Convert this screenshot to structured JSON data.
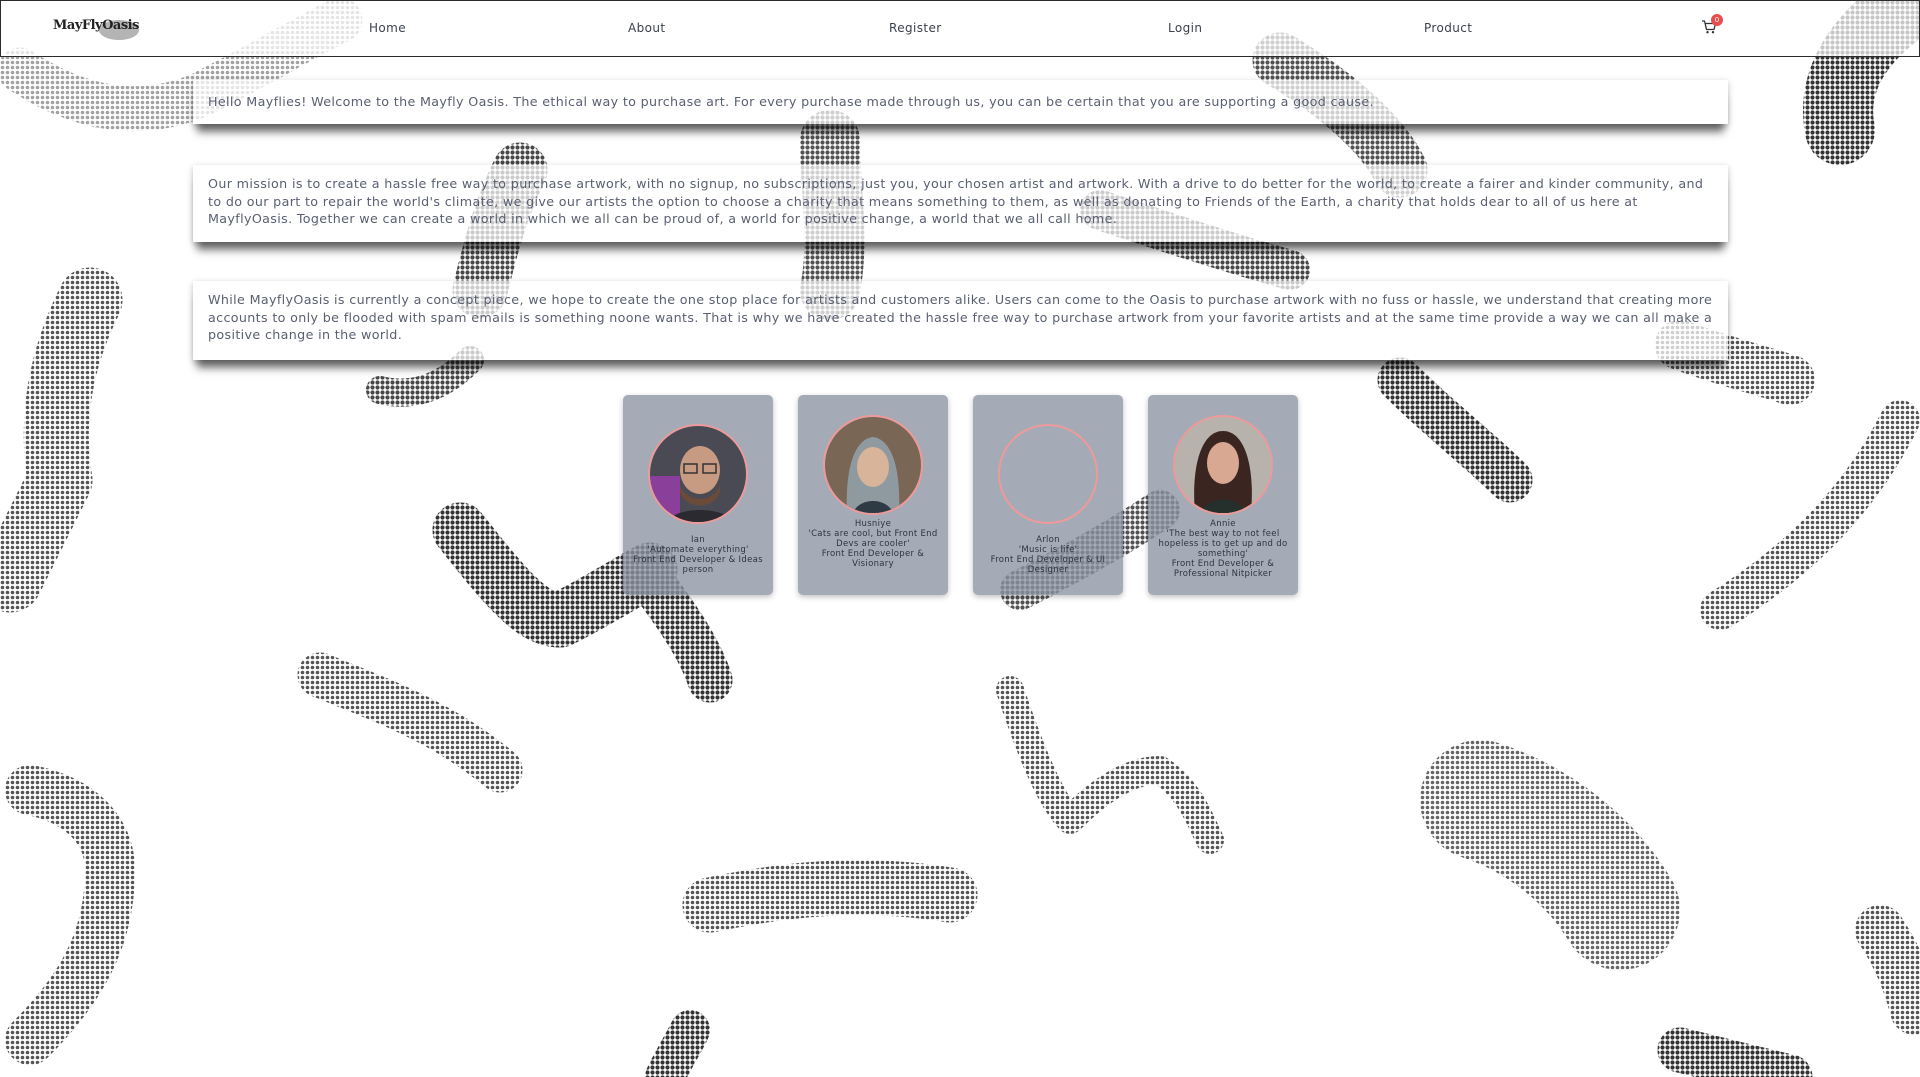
{
  "nav": {
    "logo": "MayFlyOasis",
    "links": [
      "Home",
      "About",
      "Register",
      "Login",
      "Product"
    ],
    "cart_count": "0"
  },
  "intro": {
    "welcome": "Hello Mayflies! Welcome to the Mayfly Oasis. The ethical way to purchase art. For every purchase made through us, you can be certain that you are supporting a good cause.",
    "mission": "Our mission is to create a hassle free way to purchase artwork, with no signup, no subscriptions, just you, your chosen artist and artwork. With a drive to do better for the world, to create a fairer and kinder community, and to do our part to repair the world's climate, we give our artists the option to choose a charity that means something to them, as well as donating to Friends of the Earth, a charity that holds dear to all of us here at MayflyOasis. Together we can create a world in which we all can be proud of, a world for positive change, a world that we all call home.",
    "concept": "While MayflyOasis is currently a concept piece, we hope to create the one stop place for artists and customers alike. Users can come to the Oasis to purchase artwork with no fuss or hassle, we understand that creating more accounts to only be flooded with spam emails is something noone wants. That is why we have created the hassle free way to purchase artwork from your favorite artists and at the same time provide a way we can all make a positive change in the world."
  },
  "team": [
    {
      "name": "Ian",
      "quote": "'Automate everything'",
      "role": "Front End Developer & Ideas person"
    },
    {
      "name": "Husniye",
      "quote": "'Cats are cool, but Front End Devs are cooler'",
      "role": "Front End Developer & Visionary"
    },
    {
      "name": "Arlon",
      "quote": "'Music is life'",
      "role": "Front End Developer & UI Designer"
    },
    {
      "name": "Annie",
      "quote": "'The best way to not feel hopeless is to get up and do something'",
      "role": "Front End Developer & Professional Nitpicker"
    }
  ],
  "colors": {
    "accent_border": "#ee9a9a",
    "card_bg": "#8c94a2",
    "badge": "#e84e4e",
    "text": "#5a6072"
  }
}
